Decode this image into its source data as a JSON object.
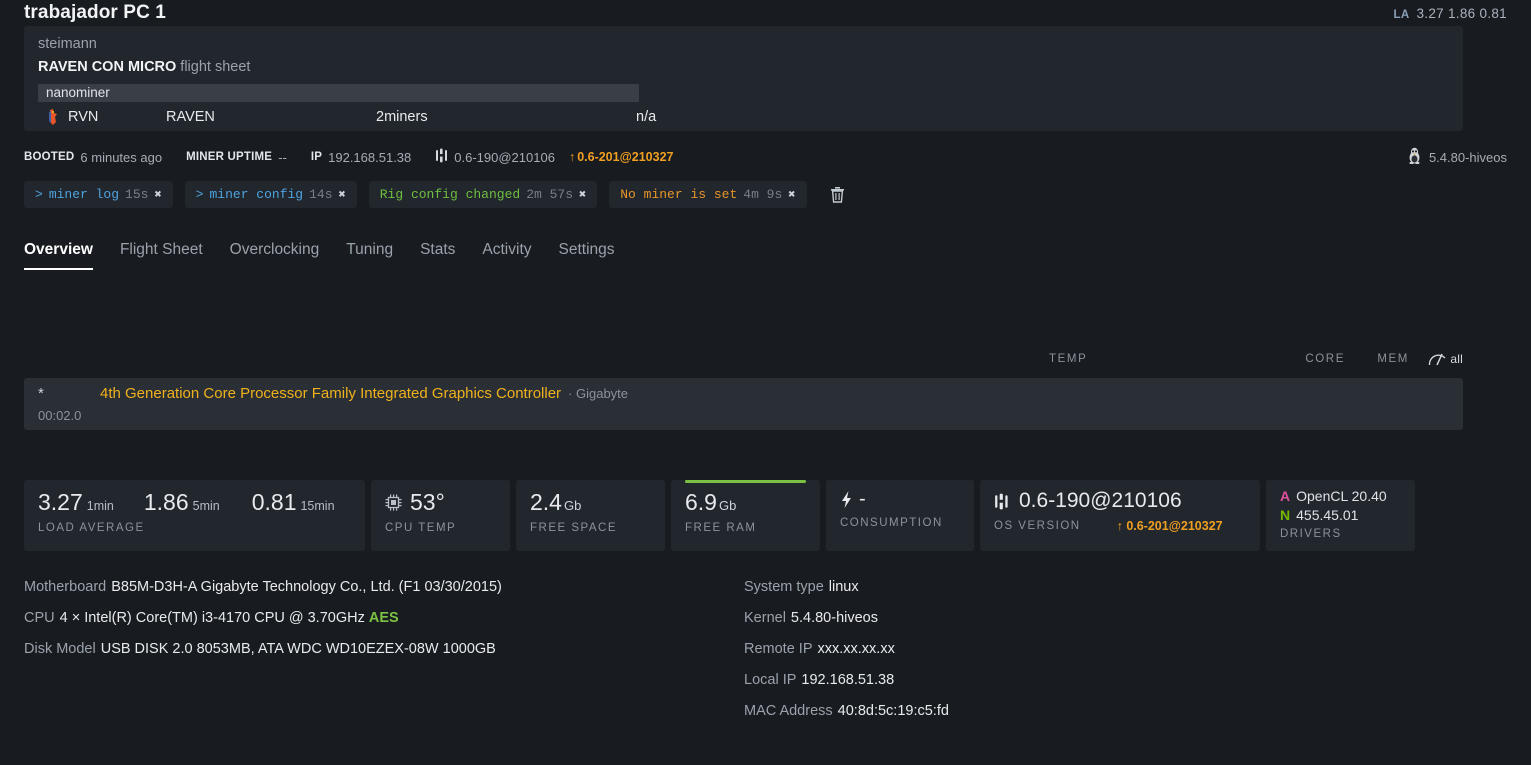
{
  "header": {
    "rig_title": "trabajador PC 1",
    "la_label": "LA",
    "la_values": "3.27 1.86 0.81"
  },
  "flight_sheet": {
    "user": "steimann",
    "name": "RAVEN CON MICRO",
    "suffix": "flight sheet",
    "miner": "nanominer",
    "coin_row": {
      "coin_icon": "rvn-coin-icon",
      "symbol": "RVN",
      "name": "RAVEN",
      "pool": "2miners",
      "wallet": "n/a"
    }
  },
  "meta": {
    "booted_label": "BOOTED",
    "booted_value": "6 minutes ago",
    "miner_uptime_label": "MINER UPTIME",
    "miner_uptime_value": "--",
    "ip_label": "IP",
    "ip_value": "192.168.51.38",
    "os_icon": "hiveos-icon",
    "os_version": "0.6-190@210106",
    "update_arrow": "↑",
    "update_version": "0.6-201@210327",
    "kernel_icon": "linux-tux-icon",
    "kernel_version": "5.4.80-hiveos"
  },
  "chips": [
    {
      "prompt": ">",
      "label": "miner log",
      "time": "15s",
      "close": "✖",
      "color": "blue"
    },
    {
      "prompt": ">",
      "label": "miner config",
      "time": "14s",
      "close": "✖",
      "color": "blue"
    },
    {
      "prompt": "",
      "label": "Rig config changed",
      "time": "2m 57s",
      "close": "✖",
      "color": "green"
    },
    {
      "prompt": "",
      "label": "No miner is set",
      "time": "4m 9s",
      "close": "✖",
      "color": "orange"
    }
  ],
  "trash_icon": "trash-icon",
  "tabs": [
    {
      "label": "Overview",
      "active": true
    },
    {
      "label": "Flight Sheet",
      "active": false
    },
    {
      "label": "Overclocking",
      "active": false
    },
    {
      "label": "Tuning",
      "active": false
    },
    {
      "label": "Stats",
      "active": false
    },
    {
      "label": "Activity",
      "active": false
    },
    {
      "label": "Settings",
      "active": false
    }
  ],
  "gpu_table": {
    "headers": {
      "temp": "TEMP",
      "core": "CORE",
      "mem": "MEM",
      "all": "all",
      "all_icon": "gauge-icon"
    },
    "rows": [
      {
        "index": "*",
        "name": "4th Generation Core Processor Family Integrated Graphics Controller",
        "brand": "· Gigabyte",
        "bus_id": "00:02.0"
      }
    ]
  },
  "cards": {
    "load_average": {
      "caption": "LOAD AVERAGE",
      "items": [
        {
          "value": "3.27",
          "period": "1min"
        },
        {
          "value": "1.86",
          "period": "5min"
        },
        {
          "value": "0.81",
          "period": "15min"
        }
      ]
    },
    "cpu_temp": {
      "icon": "cpu-chip-icon",
      "value": "53°",
      "caption": "CPU TEMP"
    },
    "free_space": {
      "value": "2.4",
      "unit": "Gb",
      "caption": "FREE SPACE"
    },
    "free_ram": {
      "value": "6.9",
      "unit": "Gb",
      "caption": "FREE RAM",
      "bar_color": "#7cc143"
    },
    "consumption": {
      "icon": "bolt-icon",
      "value": "-",
      "caption": "CONSUMPTION"
    },
    "os_version": {
      "icon": "hiveos-icon",
      "value": "0.6-190@210106",
      "caption": "OS VERSION",
      "update_arrow": "↑",
      "update_version": "0.6-201@210327"
    },
    "drivers": {
      "opencl_tag": "A",
      "opencl": "OpenCL 20.40",
      "nvidia_tag": "N",
      "nvidia": "455.45.01",
      "caption": "DRIVERS"
    }
  },
  "specs_left": [
    {
      "key": "Motherboard",
      "value": "B85M-D3H-A Gigabyte Technology Co., Ltd. (F1 03/30/2015)"
    },
    {
      "key": "CPU",
      "value": "4 × Intel(R) Core(TM) i3-4170 CPU @ 3.70GHz",
      "flag": "AES"
    },
    {
      "key": "Disk Model",
      "value": "USB DISK 2.0 8053MB, ATA WDC WD10EZEX-08W 1000GB"
    }
  ],
  "specs_right": [
    {
      "key": "System type",
      "value": "linux"
    },
    {
      "key": "Kernel",
      "value": "5.4.80-hiveos"
    },
    {
      "key": "Remote IP",
      "value": "xxx.xx.xx.xx"
    },
    {
      "key": "Local IP",
      "value": "192.168.51.38"
    },
    {
      "key": "MAC Address",
      "value": "40:8d:5c:19:c5:fd"
    }
  ],
  "colors": {
    "background": "#181b20",
    "panel": "#22262d",
    "row": "#2a2e35",
    "accent_orange": "#f0a020",
    "accent_green": "#7cc143",
    "gpu_name": "#f0b21c",
    "blue": "#4da3e0",
    "amd_pink": "#e0519e",
    "nvidia_green": "#76b900"
  }
}
